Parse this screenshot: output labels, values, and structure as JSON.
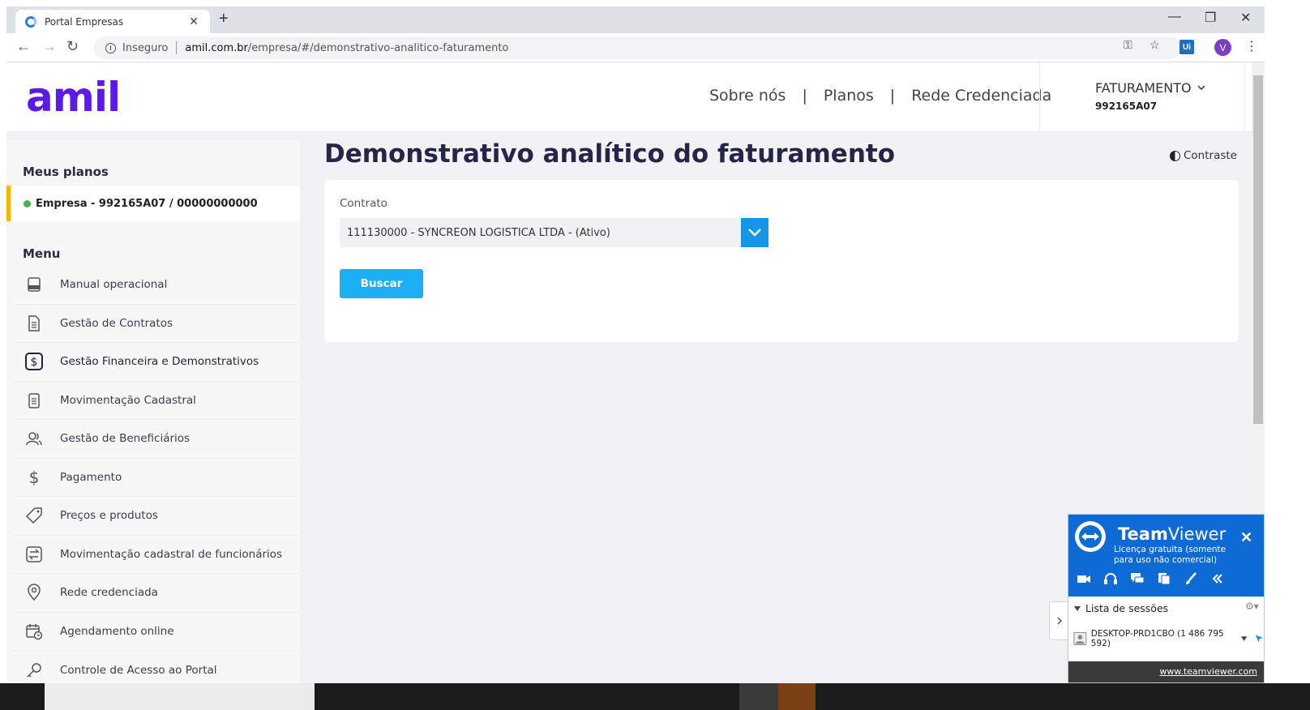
{
  "browser": {
    "tab_title": "Portal Empresas",
    "new_tab": "+",
    "close_tab": "✕",
    "insecure_label": "Inseguro",
    "url_host": "amil.com.br",
    "url_path": "/empresa/#/demonstrativo-analitico-faturamento",
    "profile_initial": "V",
    "extension_label": "Ui",
    "window_minimize": "—",
    "window_restore": "❐",
    "window_close": "✕"
  },
  "header": {
    "logo": "amil",
    "nav": [
      "Sobre nós",
      "Planos",
      "Rede Credenciada"
    ],
    "nav_divider": "|",
    "user_role": "FATURAMENTO",
    "user_code": "992165A07"
  },
  "sidebar": {
    "plans_heading": "Meus planos",
    "plan_label": "Empresa - 992165A07 / 00000000000",
    "menu_heading": "Menu",
    "items": [
      {
        "label": "Manual operacional",
        "icon": "manual-icon"
      },
      {
        "label": "Gestão de Contratos",
        "icon": "document-icon"
      },
      {
        "label": "Gestão Financeira e Demonstrativos",
        "icon": "dollar-box-icon"
      },
      {
        "label": "Movimentação Cadastral",
        "icon": "clipboard-icon"
      },
      {
        "label": "Gestão de Beneficiários",
        "icon": "users-icon"
      },
      {
        "label": "Pagamento",
        "icon": "dollar-icon"
      },
      {
        "label": "Preços e produtos",
        "icon": "price-tag-icon"
      },
      {
        "label": "Movimentação cadastral de funcionários",
        "icon": "swap-icon"
      },
      {
        "label": "Rede credenciada",
        "icon": "location-pin-icon"
      },
      {
        "label": "Agendamento online",
        "icon": "calendar-icon"
      },
      {
        "label": "Controle de Acesso ao Portal",
        "icon": "key-icon"
      }
    ]
  },
  "main": {
    "title": "Demonstrativo analítico do faturamento",
    "contrast_label": "Contraste",
    "contract_label": "Contrato",
    "contract_value": "111130000 - SYNCREON LOGISTICA LTDA - (Ativo)",
    "search_button": "Buscar"
  },
  "teamviewer": {
    "brand_bold": "Team",
    "brand_light": "Viewer",
    "license": "Licença gratuita (somente para uso não comercial)",
    "sessions_heading": "Lista de sessões",
    "session": "DESKTOP-PRD1CBO (1 486 795 592)",
    "link": "www.teamviewer.com"
  },
  "colors": {
    "brand": "#5b1be6",
    "accent": "#1ab0f3",
    "select_button": "#1596e6",
    "active_plan": "#ffb300",
    "teamviewer": "#0e6ad4"
  }
}
